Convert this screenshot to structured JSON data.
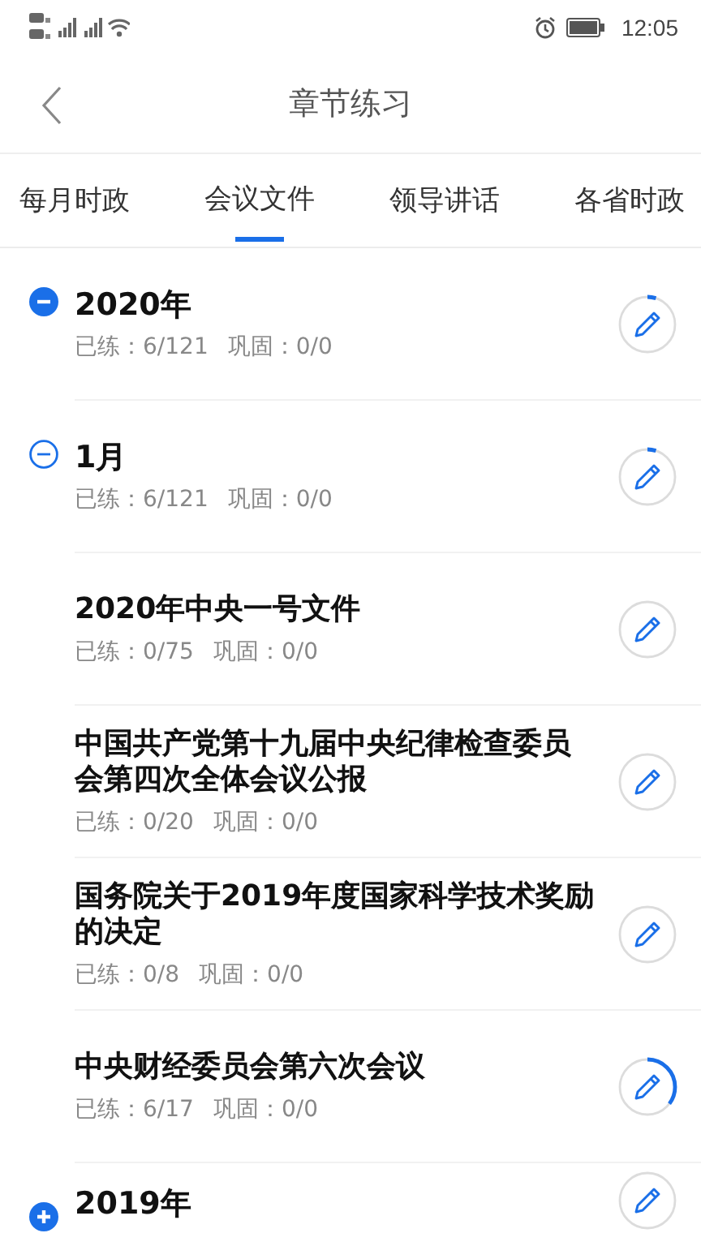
{
  "status_bar": {
    "time": "12:05"
  },
  "header": {
    "title": "章节练习"
  },
  "tabs": [
    {
      "label": "每月时政",
      "selected": false
    },
    {
      "label": "会议文件",
      "selected": true
    },
    {
      "label": "领导讲话",
      "selected": false
    },
    {
      "label": "各省时政",
      "selected": false
    }
  ],
  "tree": [
    {
      "kind": "year",
      "title": "2020年",
      "expanded": true,
      "practiced": "已练：6/121",
      "consolidated": "巩固：0/0",
      "children": [
        {
          "kind": "month",
          "title": "1月",
          "expanded": true,
          "practiced": "已练：6/121",
          "consolidated": "巩固：0/0",
          "children": [
            {
              "kind": "doc",
              "title": "2020年中央一号文件",
              "practiced": "已练：0/75",
              "consolidated": "巩固：0/0"
            },
            {
              "kind": "doc",
              "title": "中国共产党第十九届中央纪律检查委员会第四次全体会议公报",
              "practiced": "已练：0/20",
              "consolidated": "巩固：0/0"
            },
            {
              "kind": "doc",
              "title": "国务院关于2019年度国家科学技术奖励的决定",
              "practiced": "已练：0/8",
              "consolidated": "巩固：0/0"
            },
            {
              "kind": "doc",
              "title": "中央财经委员会第六次会议",
              "practiced": "已练：6/17",
              "consolidated": "巩固：0/0"
            }
          ]
        }
      ]
    },
    {
      "kind": "year",
      "title": "2019年",
      "expanded": false
    }
  ]
}
